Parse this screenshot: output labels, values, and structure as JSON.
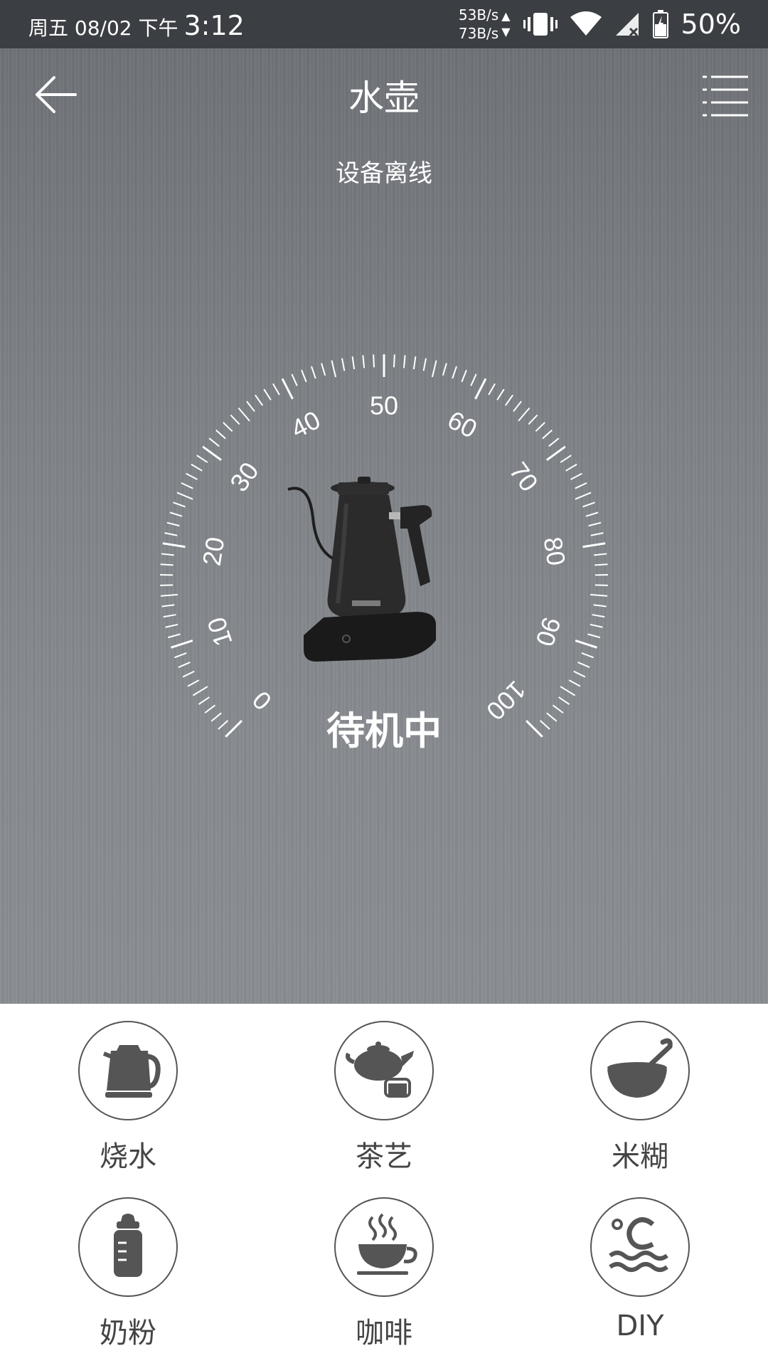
{
  "status_bar": {
    "date": "周五 08/02 下午",
    "time": "3:12",
    "net_up": "53B/s",
    "net_down": "73B/s",
    "battery": "50%"
  },
  "header": {
    "title": "水壶",
    "subtitle": "设备离线"
  },
  "gauge": {
    "min": 0,
    "max": 100,
    "tick_labels": [
      "0",
      "10",
      "20",
      "30",
      "40",
      "50",
      "60",
      "70",
      "80",
      "90",
      "100"
    ],
    "status": "待机中"
  },
  "modes": [
    {
      "label": "烧水",
      "icon": "kettle-icon"
    },
    {
      "label": "茶艺",
      "icon": "teapot-icon"
    },
    {
      "label": "米糊",
      "icon": "bowl-spoon-icon"
    },
    {
      "label": "奶粉",
      "icon": "baby-bottle-icon"
    },
    {
      "label": "咖啡",
      "icon": "coffee-cup-icon"
    },
    {
      "label": "DIY",
      "icon": "celsius-wave-icon"
    }
  ],
  "colors": {
    "status_bar": "#3b3e42",
    "icon_fill": "#555555"
  }
}
